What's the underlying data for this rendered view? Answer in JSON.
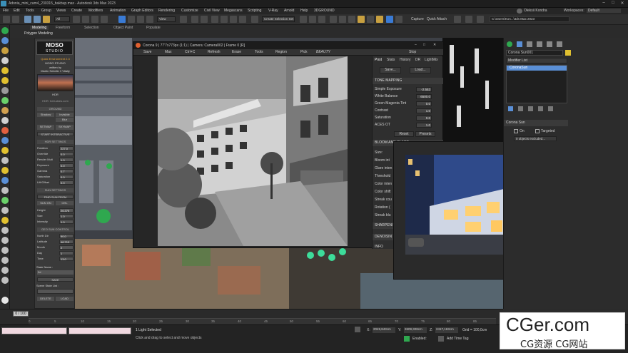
{
  "titlebar": {
    "title": "Adonia_mini_cam4_230315_bakbup.max - Autodesk 3ds Max 2023"
  },
  "menu": [
    "File",
    "Edit",
    "Tools",
    "Group",
    "Views",
    "Create",
    "Modifiers",
    "Animation",
    "Graph Editors",
    "Rendering",
    "Customize",
    "Civil View",
    "Megascans",
    "Scripting",
    "V-Ray",
    "Arnold",
    "Help",
    "3DGROUND"
  ],
  "menu_right": {
    "user": "Oleksii Kondra",
    "workspaces_label": "Workspaces:",
    "workspace": "Default"
  },
  "toolbar": {
    "selection_set": "Create Selection Set",
    "view_dropdown": "View",
    "all_dropdown": "All",
    "search_path": "C:\\Users\\Kon...\\3ds Max 2023",
    "capture": "Capture",
    "quick_attach": "Quick Attach"
  },
  "ribbon_tabs": {
    "modeling": "Modeling",
    "freeform": "Freeform",
    "selection": "Selection",
    "object_paint": "Object Paint",
    "populate": "Populate",
    "polygon_modeling": "Polygon Modeling"
  },
  "sky_panel": {
    "logo_top": "MOSO",
    "logo_bottom": "STUDIO",
    "subtitle": "Quick Environment 2.3",
    "subtitle2": "MOSO STUDIO",
    "author": "written by",
    "author_name": "Martin Sebelle // Vitaliy",
    "preset_label": "HDR",
    "hdr_site": "HDR: hdri-skies.com",
    "ground_header": "GROUND",
    "ground_btns": [
      "Shadow",
      "Invisible",
      "Blur"
    ],
    "setmap": "SETMAP",
    "skymap": "SKYMAP",
    "interactive": "START INTERACTIVE",
    "hdr_header": "HDR SETTINGS",
    "hdr_rows": [
      {
        "k": "Rotation",
        "v": "227.0"
      },
      {
        "k": "Override",
        "v": "0.0"
      },
      {
        "k": "Render Mult",
        "v": "1.0"
      },
      {
        "k": "Exposure",
        "v": "0.0"
      },
      {
        "k": "Gamma",
        "v": "0.7"
      },
      {
        "k": "Saturation",
        "v": "0.0"
      },
      {
        "k": "Lift/Offset",
        "v": "0.0"
      }
    ],
    "sun_header": "SUN SETTINGS",
    "find_sun": "FIND SUN FROM",
    "sun_on": "SUN ON",
    "ghl": "GHL",
    "sun_rows": [
      {
        "k": "Height",
        "v": "26.375"
      },
      {
        "k": "Size",
        "v": "1.0"
      },
      {
        "k": "Intensity",
        "v": "1.0"
      }
    ],
    "geo_header": "GEO SUN CONTROL",
    "geo_rows": [
      {
        "k": "North Dir",
        "v": "90.0"
      },
      {
        "k": "Latitude",
        "v": "46.713"
      },
      {
        "k": "Month",
        "v": "2"
      },
      {
        "k": "Day",
        "v": "1"
      },
      {
        "k": "Time",
        "v": "13.0"
      }
    ],
    "state_name_label": "State Name :",
    "state_name": "2d",
    "save": "SAVE",
    "scene_state_list": "Scene State List :",
    "delete": "DELETE",
    "load": "LOAD"
  },
  "vfb": {
    "title": "Corona 9 | 77'7x773px (1:1) | Camera: Camera002 | Frame 0 [R]",
    "tools": [
      "Save",
      "Max",
      "Ctrl+C",
      "Refresh",
      "Erase",
      "Tools",
      "Region",
      "Pick",
      "BEAUTY"
    ],
    "stop": "Stop",
    "panel_tabs": [
      "Post",
      "Stats",
      "History",
      "DR",
      "LightMix"
    ],
    "save_btn": "Save...",
    "load_btn": "Load...",
    "tone_header": "TONE MAPPING",
    "tone_rows": [
      {
        "k": "Simple Exposure",
        "v": "-2.553"
      },
      {
        "k": "White Balance",
        "v": "6500.0"
      },
      {
        "k": "Green Magenta Tint",
        "v": "0.0"
      },
      {
        "k": "Contrast",
        "v": "1.0"
      },
      {
        "k": "Saturation",
        "v": "0.0"
      },
      {
        "k": "ACES OT",
        "v": "1.0"
      }
    ],
    "reset_btn": "Reset",
    "presets_btn": "Presets",
    "bloom_header": "BLOOM AND GLARE",
    "bloom_rows": [
      "Size:",
      "Bloom int",
      "Glare inten",
      "Threshold",
      "Color inten",
      "Color shift",
      "Streak cou",
      "Rotation (",
      "Streak blu"
    ],
    "sharpen_header": "SHARPEN/",
    "denoise_header": "DENOISIN",
    "info_header": "INFO"
  },
  "right_panel": {
    "object_name": "Corona Sun001",
    "modifier_list": "Modifier List",
    "modifier_item": "CoronaSun",
    "sun_rollout": "Corona Sun",
    "on_label": "On",
    "targeted_label": "Targeted",
    "excluded": "0 objects excluded..."
  },
  "timeline": {
    "frame": "0 / 100",
    "ticks": [
      "0",
      "5",
      "10",
      "15",
      "20",
      "25",
      "30",
      "35",
      "40",
      "45",
      "50",
      "55",
      "60",
      "65",
      "70",
      "75",
      "80",
      "85"
    ]
  },
  "status": {
    "selection": "1 Light Selected",
    "hint": "Click and drag to select and move objects",
    "x_label": "X:",
    "x_val": "2049,843cm",
    "y_label": "Y:",
    "y_val": "2609,328cm",
    "z_label": "Z:",
    "z_val": "2417,163cm",
    "grid": "Grid = 100,0cm",
    "enabled": "Enabled:",
    "add_time_tag": "Add Time Tag"
  },
  "watermark": {
    "main": "CGer.com",
    "sub": "CG资源  CG网站"
  },
  "colors": {
    "accent_blue": "#3a7bd5",
    "panel": "#3a3a3a",
    "green": "#2fa84f",
    "selected": "#5a8fd6"
  }
}
